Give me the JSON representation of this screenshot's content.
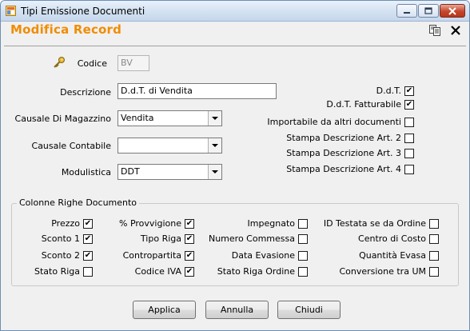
{
  "window": {
    "title": "Tipi Emissione Documenti"
  },
  "header": {
    "title": "Modifica Record",
    "icons": [
      "copy-icon",
      "close-x-icon"
    ]
  },
  "form": {
    "codice": {
      "label": "Codice",
      "value": "BV"
    },
    "descrizione": {
      "label": "Descrizione",
      "value": "D.d.T. di Vendita"
    },
    "causale_magazzino": {
      "label": "Causale Di Magazzino",
      "value": "Vendita"
    },
    "causale_contabile": {
      "label": "Causale Contabile",
      "value": ""
    },
    "modulistica": {
      "label": "Modulistica",
      "value": "DDT"
    }
  },
  "right_flags": [
    {
      "label": "D.d.T.",
      "checked": true
    },
    {
      "label": "D.d.T. Fatturabile",
      "checked": true
    },
    {
      "label": "Importabile da altri documenti",
      "checked": false
    },
    {
      "label": "Stampa Descrizione Art. 2",
      "checked": false
    },
    {
      "label": "Stampa Descrizione Art. 3",
      "checked": false
    },
    {
      "label": "Stampa Descrizione Art. 4",
      "checked": false
    }
  ],
  "columns_group": {
    "title": "Colonne Righe Documento",
    "col1": [
      {
        "label": "Prezzo",
        "checked": true
      },
      {
        "label": "Sconto 1",
        "checked": true
      },
      {
        "label": "Sconto 2",
        "checked": true
      },
      {
        "label": "Stato Riga",
        "checked": false
      }
    ],
    "col2": [
      {
        "label": "% Provvigione",
        "checked": true
      },
      {
        "label": "Tipo Riga",
        "checked": true
      },
      {
        "label": "Contropartita",
        "checked": true
      },
      {
        "label": "Codice IVA",
        "checked": true
      }
    ],
    "col3": [
      {
        "label": "Impegnato",
        "checked": false
      },
      {
        "label": "Numero Commessa",
        "checked": false
      },
      {
        "label": "Data Evasione",
        "checked": false
      },
      {
        "label": "Stato Riga Ordine",
        "checked": false
      }
    ],
    "col4": [
      {
        "label": "ID Testata se da Ordine",
        "checked": false
      },
      {
        "label": "Centro di Costo",
        "checked": false
      },
      {
        "label": "Quantità Evasa",
        "checked": false
      },
      {
        "label": "Conversione tra UM",
        "checked": false
      }
    ]
  },
  "buttons": {
    "applica": "Applica",
    "annulla": "Annulla",
    "chiudi": "Chiudi"
  }
}
